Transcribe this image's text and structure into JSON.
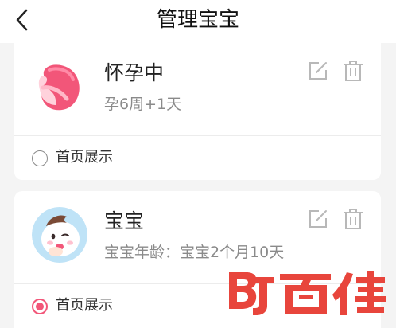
{
  "header": {
    "title": "管理宝宝",
    "back_icon": "chevron-left-icon"
  },
  "cards": [
    {
      "name": "怀孕中",
      "subtitle": "孕6周+1天",
      "homepage_label": "首页展示",
      "homepage_selected": false,
      "avatar_icon": "pregnant-belly-icon"
    },
    {
      "name": "宝宝",
      "subtitle": "宝宝年龄：宝宝2个月10天",
      "homepage_label": "首页展示",
      "homepage_selected": true,
      "avatar_icon": "baby-avatar-icon"
    }
  ],
  "icons": {
    "edit": "edit-icon",
    "delete": "trash-icon"
  },
  "colors": {
    "accent": "#f25679",
    "icon_gray": "#b8b8b8",
    "watermark": "#e8453c"
  },
  "watermark_text": "BJ百佳"
}
